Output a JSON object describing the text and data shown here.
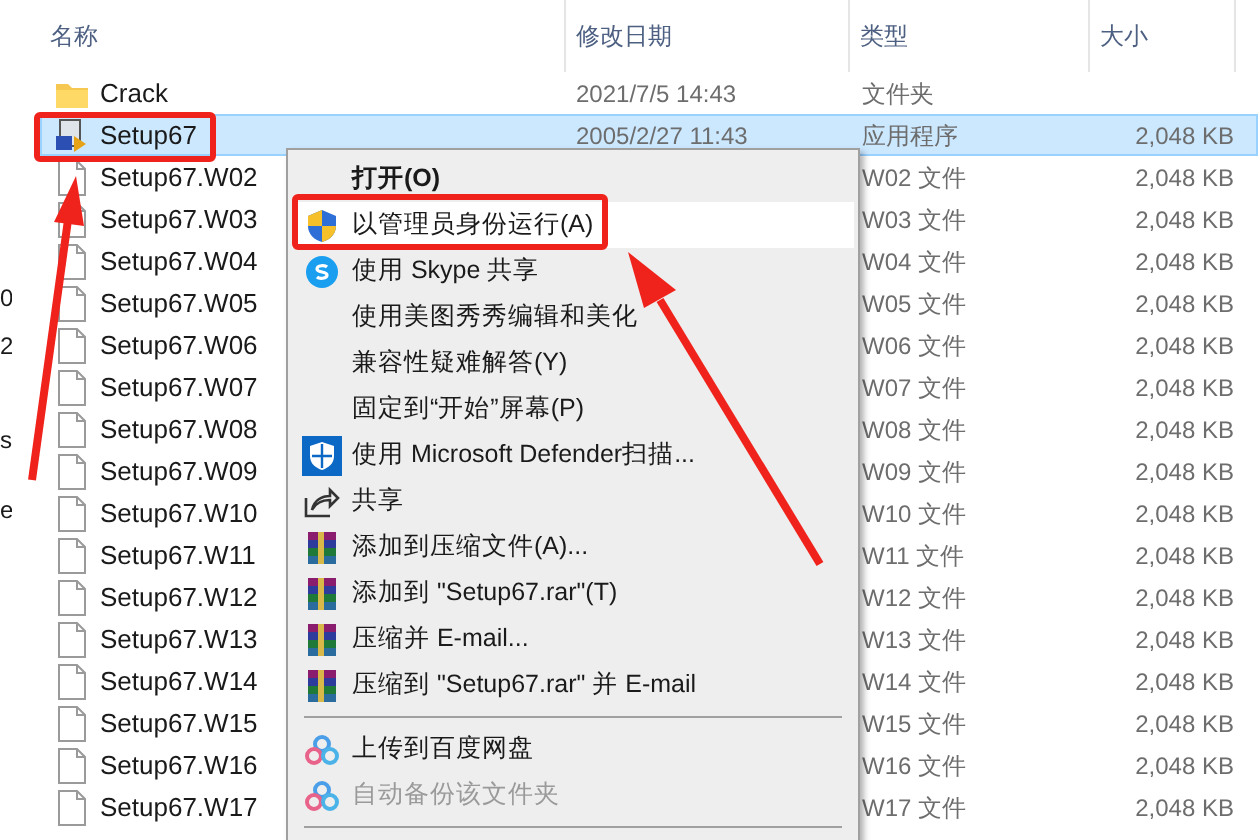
{
  "sidebar_fragments": [
    "0",
    "2",
    "s",
    "e"
  ],
  "columns": [
    "名称",
    "修改日期",
    "类型",
    "大小"
  ],
  "rows": [
    {
      "name": "Crack",
      "kind": "folder",
      "date": "2021/7/5 14:43",
      "type": "文件夹",
      "selected": false
    },
    {
      "name": "Setup67",
      "kind": "app",
      "date": "2005/2/27 11:43",
      "type": "应用程序",
      "size": "2,048 KB",
      "selected": true
    },
    {
      "name": "Setup67.W02",
      "kind": "file",
      "type": "W02 文件",
      "size": "2,048 KB",
      "selected": false
    },
    {
      "name": "Setup67.W03",
      "kind": "file",
      "type": "W03 文件",
      "size": "2,048 KB",
      "selected": false
    },
    {
      "name": "Setup67.W04",
      "kind": "file",
      "type": "W04 文件",
      "size": "2,048 KB",
      "selected": false
    },
    {
      "name": "Setup67.W05",
      "kind": "file",
      "type": "W05 文件",
      "size": "2,048 KB",
      "selected": false
    },
    {
      "name": "Setup67.W06",
      "kind": "file",
      "type": "W06 文件",
      "size": "2,048 KB",
      "selected": false
    },
    {
      "name": "Setup67.W07",
      "kind": "file",
      "type": "W07 文件",
      "size": "2,048 KB",
      "selected": false
    },
    {
      "name": "Setup67.W08",
      "kind": "file",
      "type": "W08 文件",
      "size": "2,048 KB",
      "selected": false
    },
    {
      "name": "Setup67.W09",
      "kind": "file",
      "type": "W09 文件",
      "size": "2,048 KB",
      "selected": false
    },
    {
      "name": "Setup67.W10",
      "kind": "file",
      "type": "W10 文件",
      "size": "2,048 KB",
      "selected": false
    },
    {
      "name": "Setup67.W11",
      "kind": "file",
      "type": "W11 文件",
      "size": "2,048 KB",
      "selected": false
    },
    {
      "name": "Setup67.W12",
      "kind": "file",
      "type": "W12 文件",
      "size": "2,048 KB",
      "selected": false
    },
    {
      "name": "Setup67.W13",
      "kind": "file",
      "type": "W13 文件",
      "size": "2,048 KB",
      "selected": false
    },
    {
      "name": "Setup67.W14",
      "kind": "file",
      "type": "W14 文件",
      "size": "2,048 KB",
      "selected": false
    },
    {
      "name": "Setup67.W15",
      "kind": "file",
      "type": "W15 文件",
      "size": "2,048 KB",
      "selected": false
    },
    {
      "name": "Setup67.W16",
      "kind": "file",
      "type": "W16 文件",
      "size": "2,048 KB",
      "selected": false
    },
    {
      "name": "Setup67.W17",
      "kind": "file",
      "type": "W17 文件",
      "size": "2,048 KB",
      "selected": false
    }
  ],
  "context_menu": [
    {
      "kind": "plain",
      "label": "打开(O)",
      "bold": true,
      "highlighted": false,
      "disabled": false
    },
    {
      "kind": "shield",
      "label": "以管理员身份运行(A)",
      "bold": false,
      "highlighted": true,
      "disabled": false
    },
    {
      "kind": "skype",
      "label": "使用 Skype 共享",
      "bold": false,
      "highlighted": false,
      "disabled": false
    },
    {
      "kind": "plain",
      "label": "使用美图秀秀编辑和美化",
      "bold": false,
      "highlighted": false,
      "disabled": false
    },
    {
      "kind": "plain",
      "label": "兼容性疑难解答(Y)",
      "bold": false,
      "highlighted": false,
      "disabled": false
    },
    {
      "kind": "plain",
      "label": "固定到“开始”屏幕(P)",
      "bold": false,
      "highlighted": false,
      "disabled": false
    },
    {
      "kind": "defender",
      "label": "使用 Microsoft Defender扫描...",
      "bold": false,
      "highlighted": false,
      "disabled": false
    },
    {
      "kind": "share",
      "label": "共享",
      "bold": false,
      "highlighted": false,
      "disabled": false
    },
    {
      "kind": "archive",
      "label": "添加到压缩文件(A)...",
      "bold": false,
      "highlighted": false,
      "disabled": false
    },
    {
      "kind": "archive",
      "label": "添加到 \"Setup67.rar\"(T)",
      "bold": false,
      "highlighted": false,
      "disabled": false
    },
    {
      "kind": "archive",
      "label": "压缩并 E-mail...",
      "bold": false,
      "highlighted": false,
      "disabled": false
    },
    {
      "kind": "archive",
      "label": "压缩到 \"Setup67.rar\" 并 E-mail",
      "bold": false,
      "highlighted": false,
      "disabled": false
    },
    {
      "kind": "separator"
    },
    {
      "kind": "cloud",
      "label": "上传到百度网盘",
      "bold": false,
      "highlighted": false,
      "disabled": false
    },
    {
      "kind": "cloud",
      "label": "自动备份该文件夹",
      "bold": false,
      "highlighted": false,
      "disabled": true
    },
    {
      "kind": "separator"
    }
  ]
}
